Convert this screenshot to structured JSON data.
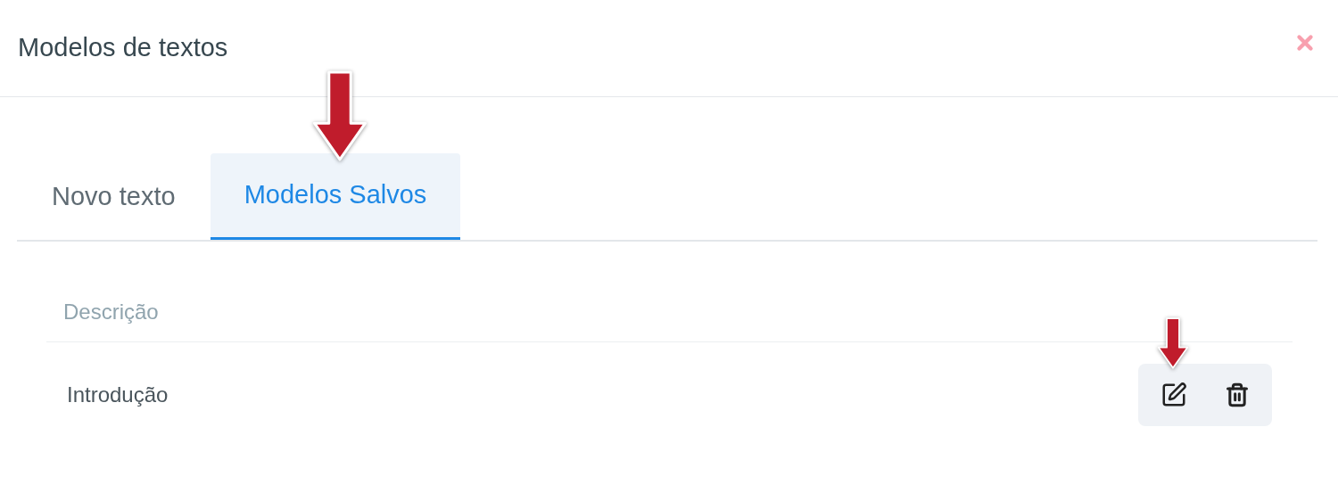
{
  "dialog": {
    "title": "Modelos de textos"
  },
  "tabs": [
    {
      "label": "Novo texto",
      "selected": false
    },
    {
      "label": "Modelos Salvos",
      "selected": true
    }
  ],
  "table": {
    "columns": [
      "Descrição"
    ],
    "rows": [
      {
        "description": "Introdução"
      }
    ]
  }
}
